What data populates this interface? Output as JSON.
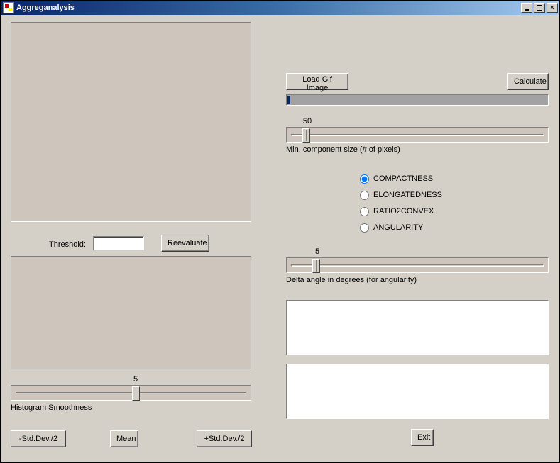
{
  "window": {
    "title": "Aggreganalysis"
  },
  "left": {
    "threshold_label": "Threshold:",
    "threshold_value": "",
    "reevaluate": "Reevaluate",
    "hist_caption": "Histogram Smoothness",
    "hist_value": "5",
    "btn_minus": "-Std.Dev./2",
    "btn_mean": "Mean",
    "btn_plus": "+Std.Dev./2"
  },
  "right": {
    "load": "Load Gif Image",
    "calculate": "Calculate",
    "mincomp_value": "50",
    "mincomp_caption": "Min. component size (# of pixels)",
    "metrics": {
      "compactness": "COMPACTNESS",
      "elongatedness": "ELONGATEDNESS",
      "ratio2convex": "RATIO2CONVEX",
      "angularity": "ANGULARITY"
    },
    "delta_value": "5",
    "delta_caption": "Delta angle in degrees (for angularity)",
    "exit": "Exit"
  }
}
